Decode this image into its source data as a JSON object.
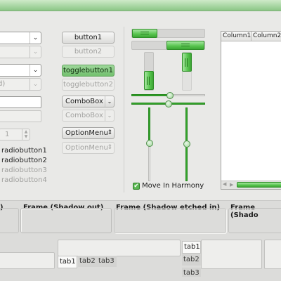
{
  "left": {
    "combo1_arrow": "⌄",
    "combo2_arrow": "⌄",
    "combo3_arrow": "⌄",
    "combo4_arrow": "⌄",
    "combo4_text": "d)",
    "spin_value": "1",
    "spin_up": "▲",
    "spin_down": "▼",
    "radios": [
      "radiobutton1",
      "radiobutton2",
      "radiobutton3",
      "radiobutton4"
    ]
  },
  "buttons": {
    "button1": "button1",
    "button2": "button2",
    "toggle1": "togglebutton1",
    "toggle2": "togglebutton2",
    "combo1": "ComboBox",
    "combo2": "ComboBox",
    "combo_arrow": "⌄",
    "option1": "OptionMenu",
    "option2": "OptionMenu",
    "option_arrow": "⇕"
  },
  "scales": {
    "progress_h1": 0.34,
    "progress_h2": 0.51,
    "hscale1": 0.5,
    "hscale2": 0.5,
    "move_in_harmony_label": "Move In Harmony",
    "check_mark": "✔"
  },
  "tree": {
    "columns": [
      "Column1",
      "Column2"
    ],
    "scroll_left": "◀",
    "scroll_right": "▶"
  },
  "frames": [
    {
      "title": ")"
    },
    {
      "title": "Frame (Shadow out)"
    },
    {
      "title": "Frame (Shadow etched in)"
    },
    {
      "title": "Frame (Shado"
    }
  ],
  "notebooks": {
    "nb1_tabs": [
      "tab1",
      "tab2",
      "tab3"
    ],
    "nb2_tabs": [
      "tab1",
      "tab2",
      "tab3"
    ]
  },
  "colors": {
    "accent": "#56c44d",
    "accent_dark": "#2f8f28",
    "window_bg": "#e9e9e7"
  }
}
